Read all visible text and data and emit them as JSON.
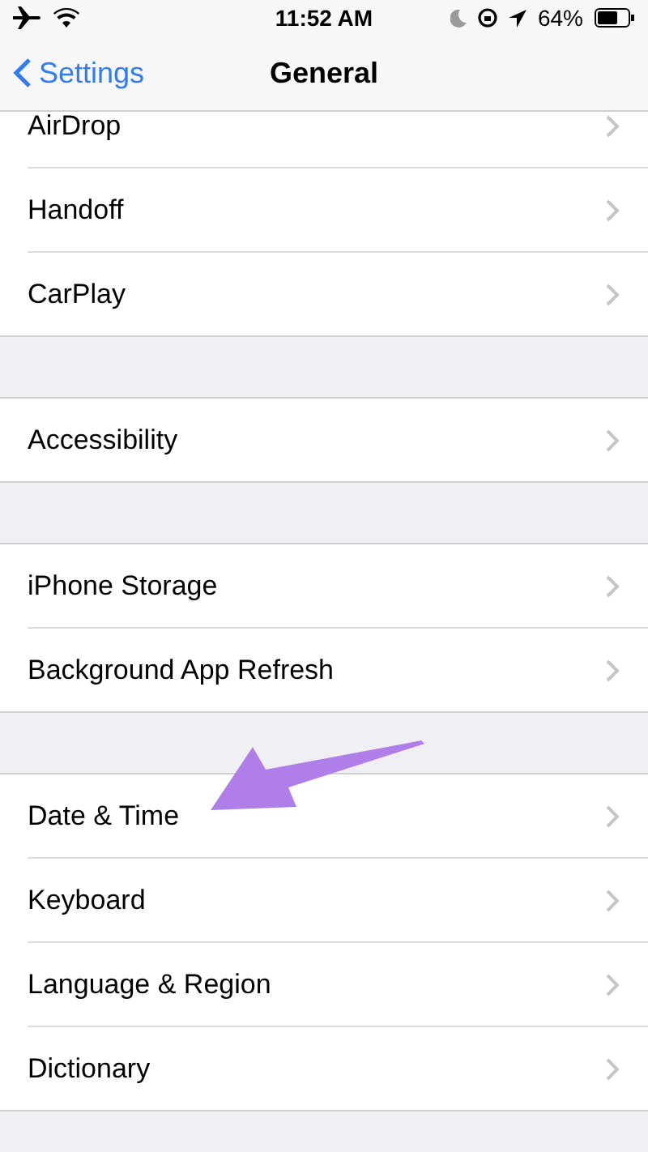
{
  "status_bar": {
    "time": "11:52 AM",
    "battery": "64%"
  },
  "nav_bar": {
    "back": "Settings",
    "title": "General"
  },
  "groups": [
    {
      "rows": [
        "AirDrop",
        "Handoff",
        "CarPlay"
      ]
    },
    {
      "rows": [
        "Accessibility"
      ]
    },
    {
      "rows": [
        "iPhone Storage",
        "Background App Refresh"
      ]
    },
    {
      "rows": [
        "Date & Time",
        "Keyboard",
        "Language & Region",
        "Dictionary"
      ]
    }
  ]
}
